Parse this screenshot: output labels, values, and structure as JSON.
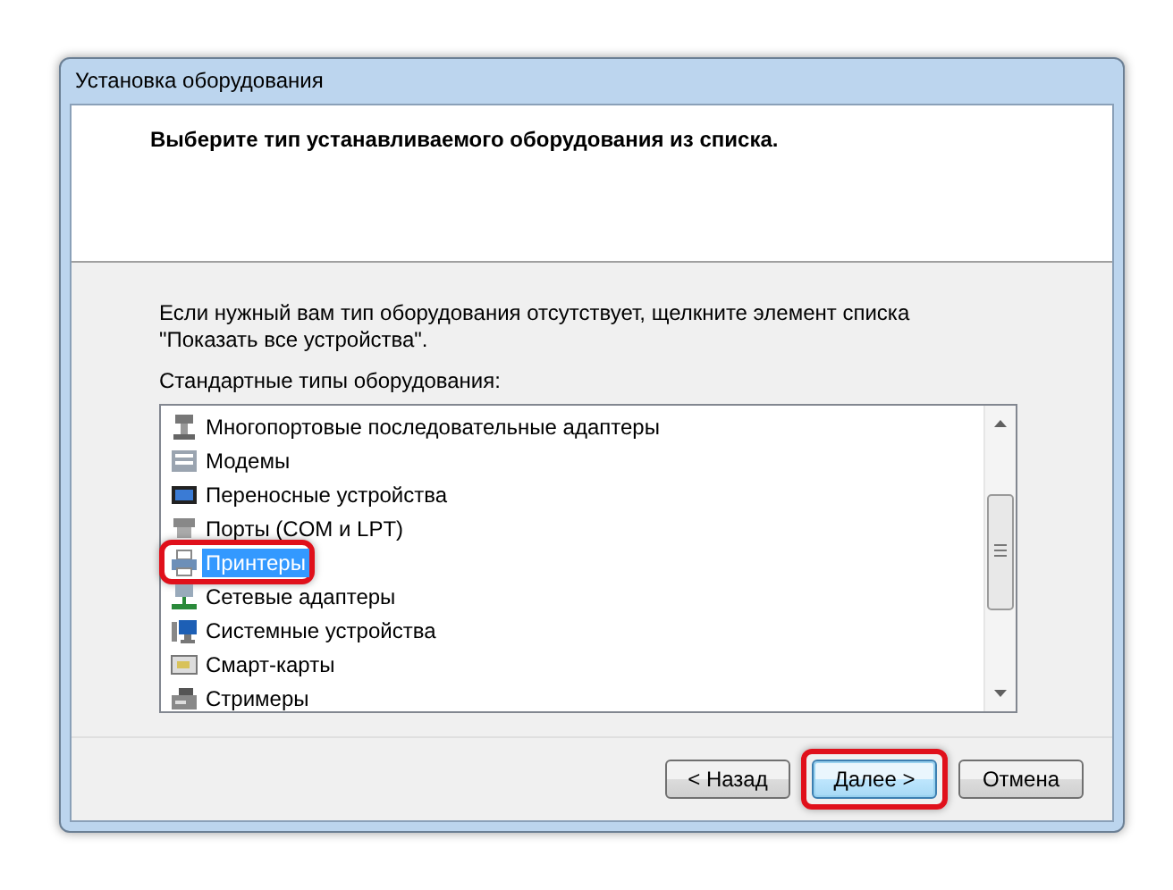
{
  "window": {
    "title": "Установка оборудования"
  },
  "header": {
    "heading": "Выберите тип устанавливаемого оборудования из списка."
  },
  "instruction": "Если нужный вам тип оборудования отсутствует, щелкните элемент списка \"Показать все устройства\".",
  "list": {
    "label": "Стандартные типы оборудования:",
    "items": [
      {
        "label": "Многопортовые последовательные адаптеры",
        "selected": false,
        "highlighted": false
      },
      {
        "label": "Модемы",
        "selected": false,
        "highlighted": false
      },
      {
        "label": "Переносные устройства",
        "selected": false,
        "highlighted": false
      },
      {
        "label": "Порты (COM и LPT)",
        "selected": false,
        "highlighted": false
      },
      {
        "label": "Принтеры",
        "selected": true,
        "highlighted": true
      },
      {
        "label": "Сетевые адаптеры",
        "selected": false,
        "highlighted": false
      },
      {
        "label": "Системные устройства",
        "selected": false,
        "highlighted": false
      },
      {
        "label": "Смарт-карты",
        "selected": false,
        "highlighted": false
      },
      {
        "label": "Стримеры",
        "selected": false,
        "highlighted": false
      }
    ]
  },
  "buttons": [
    {
      "label": "< Назад",
      "default": false,
      "highlighted": false
    },
    {
      "label": "Далее >",
      "default": true,
      "highlighted": true
    },
    {
      "label": "Отмена",
      "default": false,
      "highlighted": false
    }
  ]
}
